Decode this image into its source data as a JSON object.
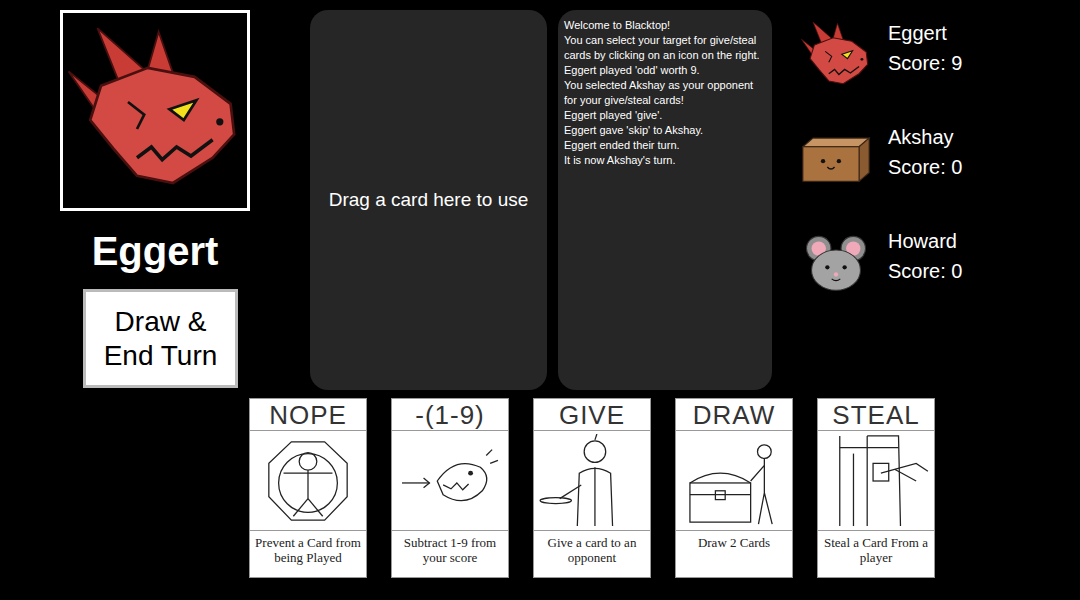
{
  "player": {
    "name": "Eggert",
    "kind": "dragon"
  },
  "button": "Draw & End Turn",
  "drop_zone": "Drag a card here to use",
  "log": [
    "Welcome to Blacktop!",
    "You can select your target for give/steal cards by clicking on an icon on the right.",
    "Eggert played 'odd' worth 9.",
    "You selected Akshay as your opponent for your give/steal cards!",
    "Eggert played 'give'.",
    "Eggert gave 'skip' to Akshay.",
    "Eggert ended their turn.",
    "It is now Akshay's turn."
  ],
  "players": [
    {
      "name": "Eggert",
      "score": "Score: 9",
      "kind": "dragon"
    },
    {
      "name": "Akshay",
      "score": "Score: 0",
      "kind": "box"
    },
    {
      "name": "Howard",
      "score": "Score: 0",
      "kind": "mouse"
    }
  ],
  "hand": [
    {
      "title": "NOPE",
      "description": "Prevent a Card from being Played",
      "kind": "nope"
    },
    {
      "title": "-(1-9)",
      "description": "Subtract 1-9 from your score",
      "kind": "subtract"
    },
    {
      "title": "GIVE",
      "description": "Give a card to an opponent",
      "kind": "give"
    },
    {
      "title": "DRAW",
      "description": "Draw 2 Cards",
      "kind": "draw"
    },
    {
      "title": "STEAL",
      "description": "Steal a Card From a player",
      "kind": "steal"
    }
  ]
}
